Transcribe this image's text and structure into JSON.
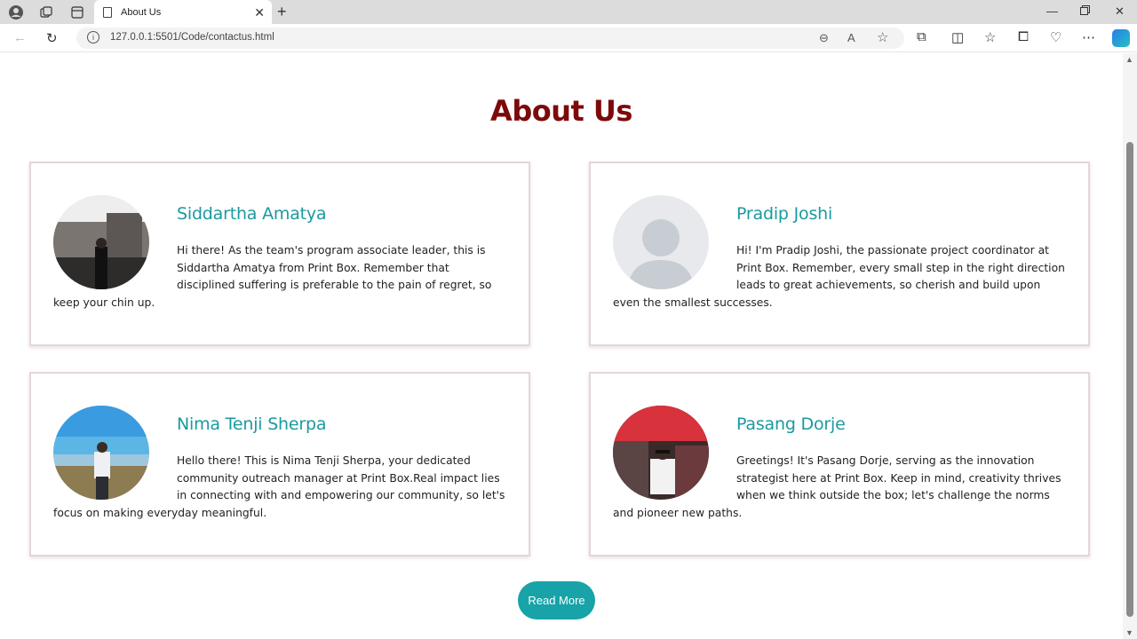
{
  "browser": {
    "tab_title": "About Us",
    "url": "127.0.0.1:5501/Code/contactus.html"
  },
  "page": {
    "title": "About Us",
    "read_more_label": "Read More"
  },
  "members": [
    {
      "name": "Siddartha Amatya",
      "bio": "Hi there! As the team's program associate leader, this is Siddartha Amatya from Print Box. Remember that disciplined suffering is preferable to the pain of regret, so keep your chin up."
    },
    {
      "name": "Pradip Joshi",
      "bio": "Hi! I'm Pradip Joshi, the passionate project coordinator at Print Box. Remember, every small step in the right direction leads to great achievements, so cherish and build upon even the smallest successes."
    },
    {
      "name": "Nima Tenji Sherpa",
      "bio": "Hello there! This is Nima Tenji Sherpa, your dedicated community outreach manager at Print Box.Real impact lies in connecting with and empowering our community, so let's focus on making everyday meaningful."
    },
    {
      "name": "Pasang Dorje",
      "bio": "Greetings! It's Pasang Dorje, serving as the innovation strategist here at Print Box. Keep in mind, creativity thrives when we think outside the box; let's challenge the norms and pioneer new paths."
    }
  ],
  "colors": {
    "title": "#7d0a0a",
    "name": "#1a9aa0",
    "button": "#17a3a8"
  }
}
